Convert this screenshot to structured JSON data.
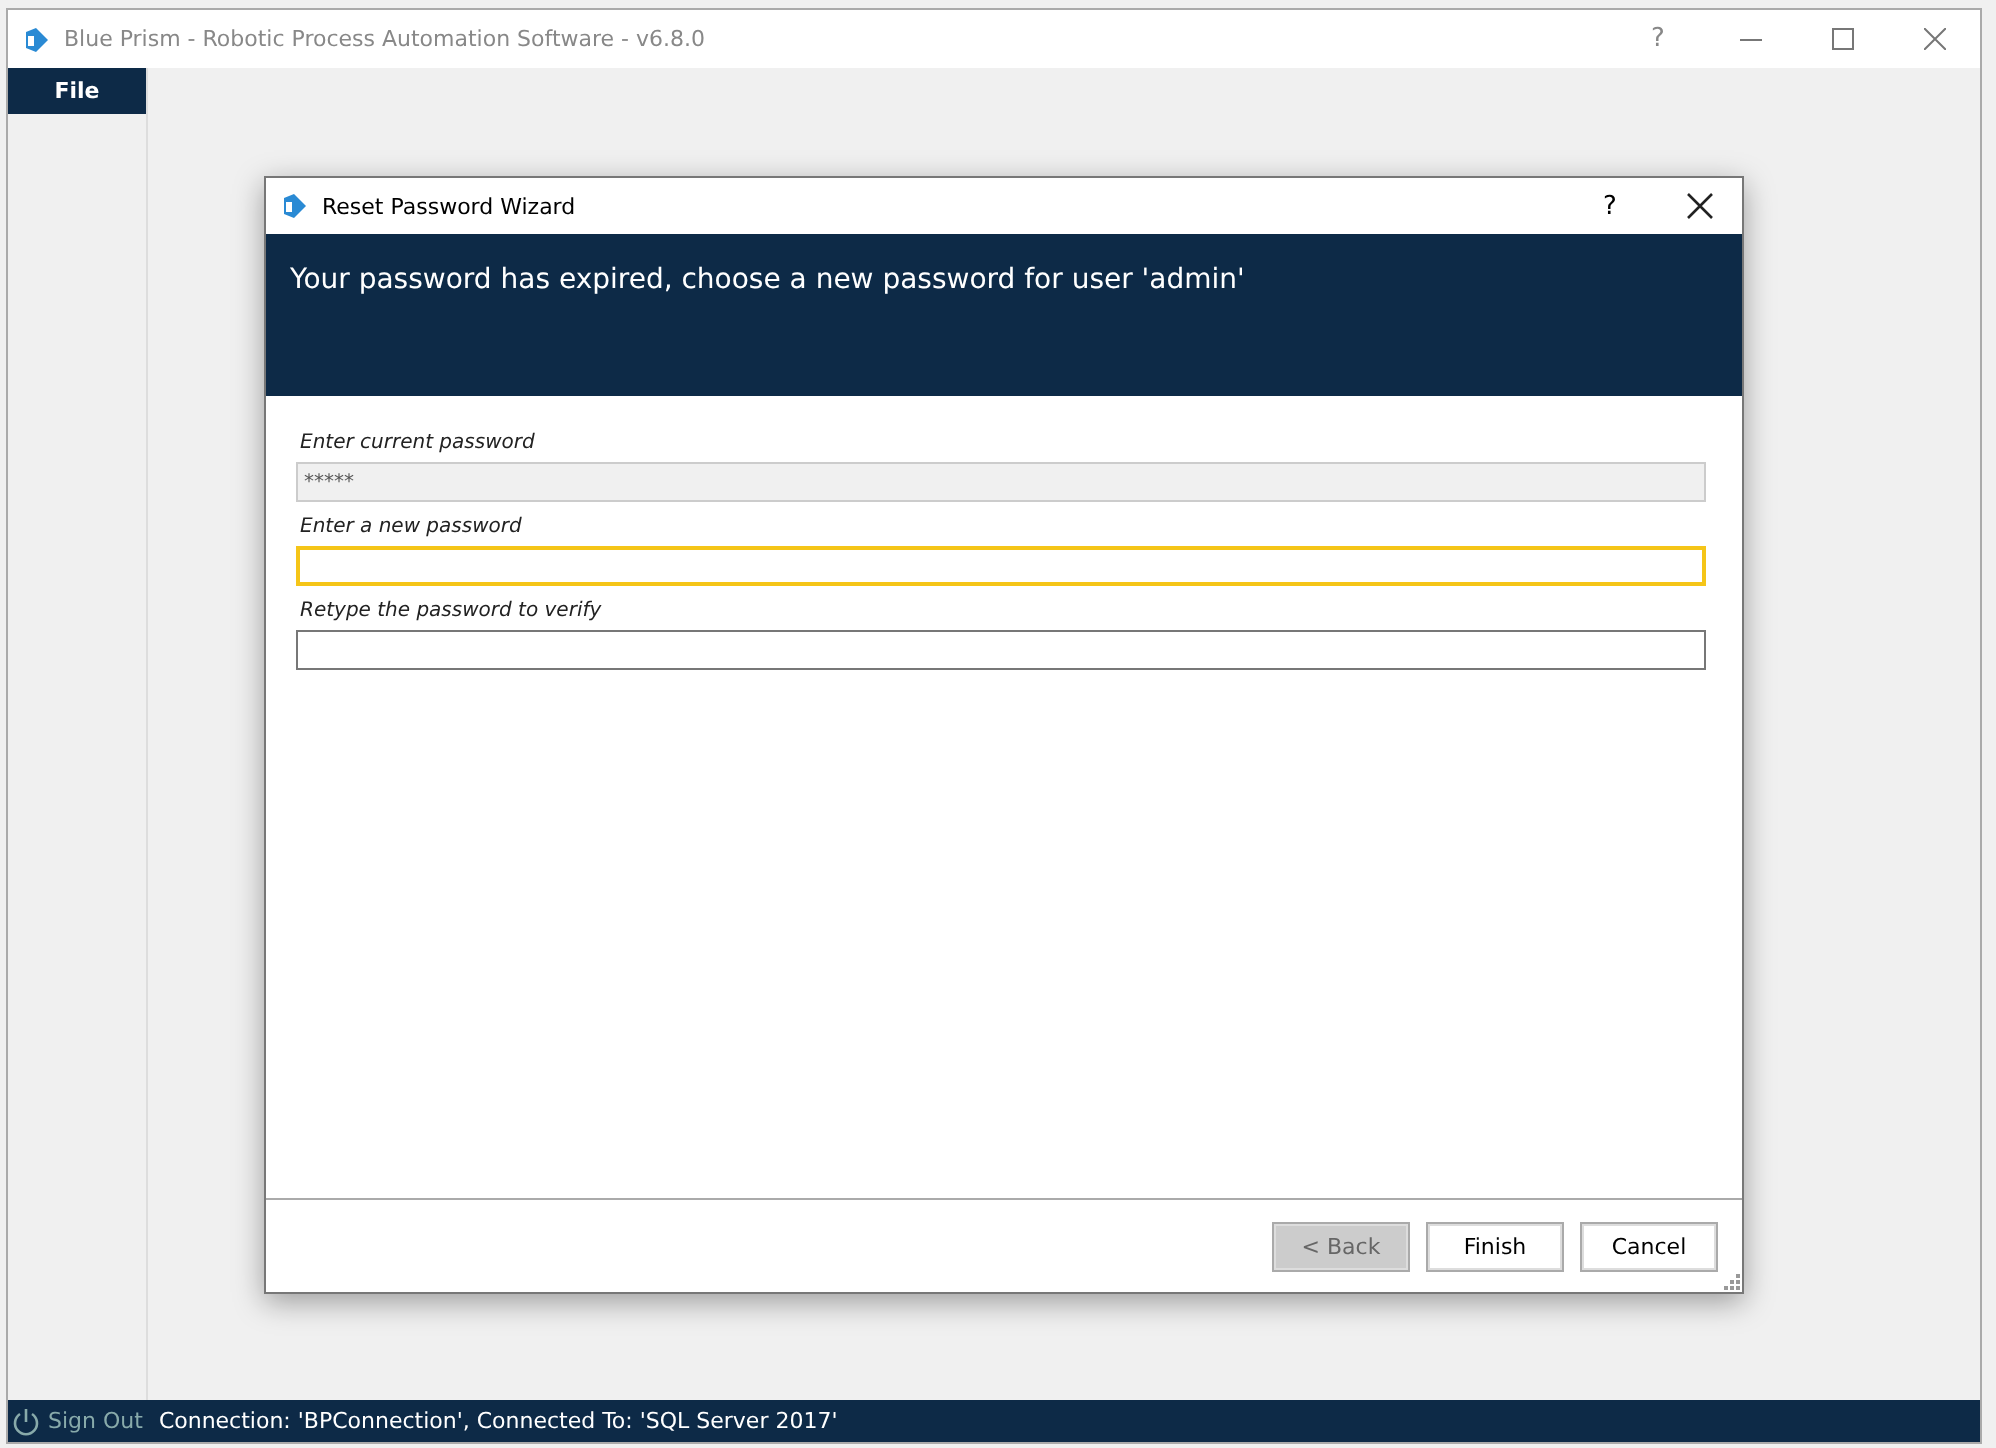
{
  "window": {
    "title": "Blue Prism - Robotic Process Automation Software - v6.8.0",
    "help": "?"
  },
  "menu": [
    {
      "label": "File",
      "selected": true
    }
  ],
  "dialog": {
    "title": "Reset Password Wizard",
    "help": "?",
    "heading": "Your password has expired, choose a new password for user 'admin'",
    "fields": [
      {
        "label": "Enter current password",
        "value": "*****",
        "disabled": true,
        "focused": false
      },
      {
        "label": "Enter a new password",
        "disabled": false,
        "focused": true
      },
      {
        "label": "Retype the password to verify",
        "disabled": false,
        "focused": false
      }
    ],
    "buttons": [
      {
        "label": "< Back",
        "disabled": true
      },
      {
        "label": "Finish",
        "disabled": false
      },
      {
        "label": "Cancel",
        "disabled": false
      }
    ]
  },
  "status_bar": {
    "sign_out": {
      "label": "Sign Out",
      "disabled": true
    },
    "connection": "Connection: 'BPConnection', Connected To: 'SQL Server 2017'"
  }
}
